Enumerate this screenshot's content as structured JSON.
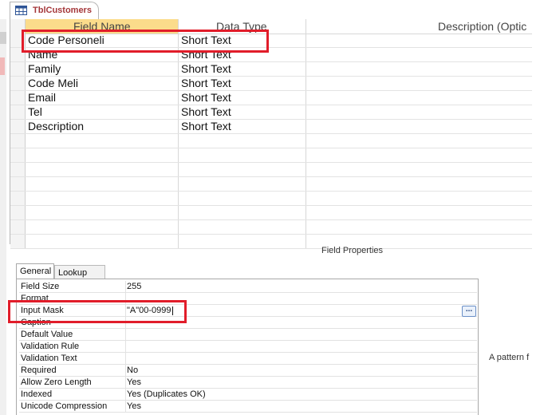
{
  "tab": {
    "title": "TblCustomers",
    "icon": "table-icon"
  },
  "grid": {
    "headers": {
      "field_name": "Field Name",
      "data_type": "Data Type",
      "description": "Description (Optic"
    },
    "rows": [
      {
        "field": "Code Personeli",
        "type": "Short Text"
      },
      {
        "field": "Name",
        "type": "Short Text"
      },
      {
        "field": "Family",
        "type": "Short Text"
      },
      {
        "field": "Code Meli",
        "type": "Short Text"
      },
      {
        "field": "Email",
        "type": "Short Text"
      },
      {
        "field": "Tel",
        "type": "Short Text"
      },
      {
        "field": "Description",
        "type": "Short Text"
      }
    ]
  },
  "field_properties": {
    "label": "Field Properties",
    "tabs": [
      "General",
      "Lookup"
    ],
    "rows": [
      {
        "label": "Field Size",
        "value": "255"
      },
      {
        "label": "Format",
        "value": ""
      },
      {
        "label": "Input Mask",
        "value": "\"A\"00-0999"
      },
      {
        "label": "Caption",
        "value": ""
      },
      {
        "label": "Default Value",
        "value": ""
      },
      {
        "label": "Validation Rule",
        "value": ""
      },
      {
        "label": "Validation Text",
        "value": ""
      },
      {
        "label": "Required",
        "value": "No"
      },
      {
        "label": "Allow Zero Length",
        "value": "Yes"
      },
      {
        "label": "Indexed",
        "value": "Yes (Duplicates OK)"
      },
      {
        "label": "Unicode Compression",
        "value": "Yes"
      }
    ],
    "ellipsis_label": "...",
    "help_text": "A pattern f"
  },
  "colors": {
    "highlight_red": "#e11d2a",
    "header_orange": "#fbdc8b",
    "tab_title": "#a4373a"
  }
}
